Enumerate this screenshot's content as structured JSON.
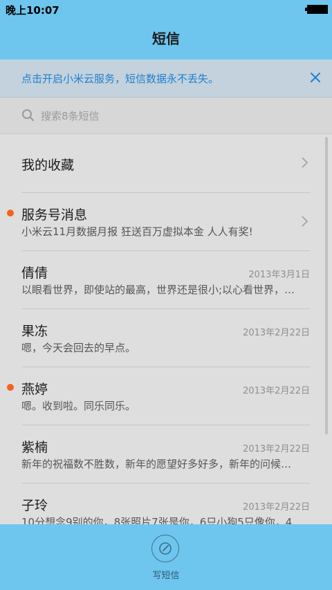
{
  "status_bar": {
    "time": "晚上10:07"
  },
  "header": {
    "title": "短信"
  },
  "banner": {
    "text": "点击开启小米云服务，短信数据永不丢失。"
  },
  "search": {
    "placeholder": "搜索8条短信"
  },
  "conversations": [
    {
      "name": "我的收藏",
      "preview": "",
      "date": "",
      "unread": false,
      "has_chevron": true
    },
    {
      "name": "服务号消息",
      "preview": "小米云11月数据月报 狂送百万虚拟本金 人人有奖!",
      "date": "",
      "unread": true,
      "has_chevron": true
    },
    {
      "name": "倩倩",
      "preview": "以眼看世界，即使站的最高，世界还是很小;以心看世界，…",
      "date": "2013年3月1日",
      "unread": false,
      "has_chevron": false
    },
    {
      "name": "果冻",
      "preview": "嗯，今天会回去的早点。",
      "date": "2013年2月22日",
      "unread": false,
      "has_chevron": false
    },
    {
      "name": "燕婷",
      "preview": "嗯。收到啦。同乐同乐。",
      "date": "2013年2月22日",
      "unread": true,
      "has_chevron": false
    },
    {
      "name": "紫楠",
      "preview": "新年的祝福数不胜数，新年的愿望好多好多，新年的问候…",
      "date": "2013年2月22日",
      "unread": false,
      "has_chevron": false
    },
    {
      "name": "子玲",
      "preview": "10分想念9别的你，8张照片7张是你，6只小狗5只像你，4…",
      "date": "2013年2月22日",
      "unread": false,
      "has_chevron": false
    }
  ],
  "bottom_bar": {
    "compose_label": "写短信"
  },
  "colors": {
    "accent": "#6ec6ef",
    "link": "#1f7fd0",
    "unread_dot": "#f4621c"
  },
  "icons": {
    "search": "search-icon",
    "close": "close-icon",
    "compose": "compose-icon",
    "chevron": "chevron-right-icon"
  }
}
